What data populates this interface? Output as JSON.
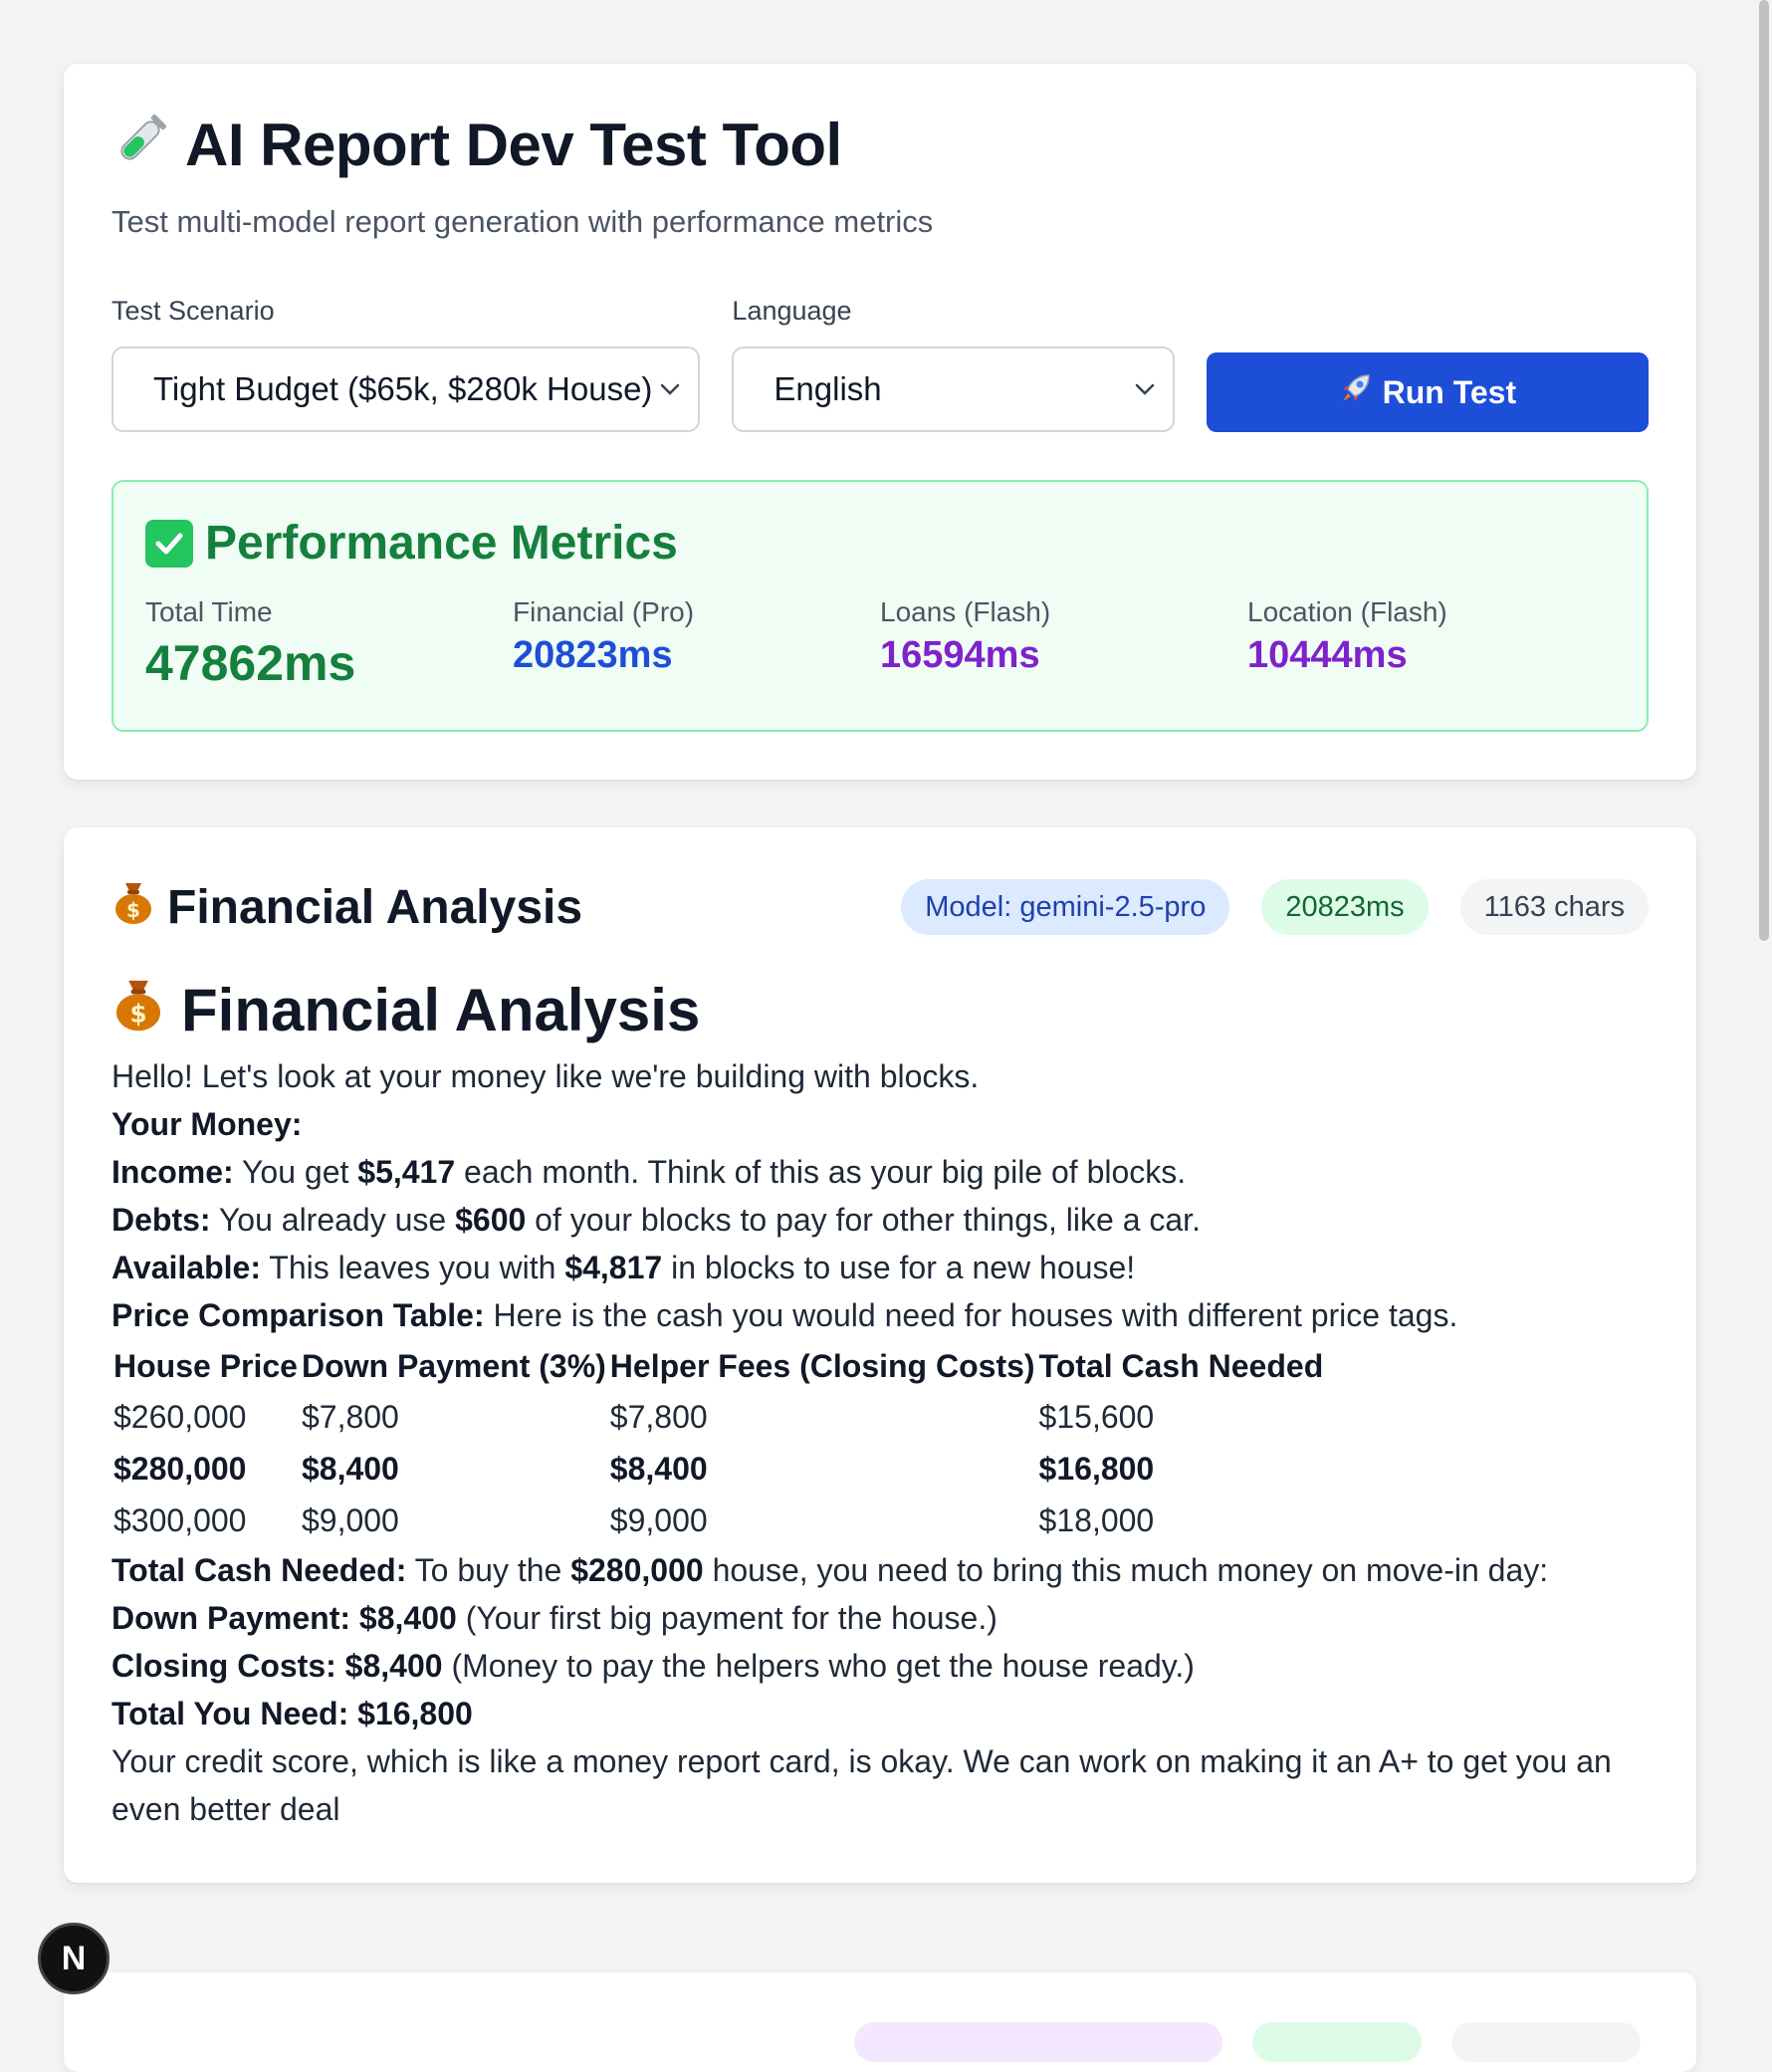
{
  "header": {
    "icon": "test-tube-icon",
    "title": "AI Report Dev Test Tool",
    "subtitle": "Test multi-model report generation with performance metrics"
  },
  "controls": {
    "scenario_label": "Test Scenario",
    "scenario_value": "Tight Budget ($65k, $280k House)",
    "language_label": "Language",
    "language_value": "English",
    "run_button_label": "Run Test",
    "run_button_icon": "rocket-icon"
  },
  "metrics": {
    "title": "Performance Metrics",
    "items": [
      {
        "label": "Total Time",
        "value": "47862ms",
        "color": "#15803d"
      },
      {
        "label": "Financial (Pro)",
        "value": "20823ms",
        "color": "#1d4ed8"
      },
      {
        "label": "Loans (Flash)",
        "value": "16594ms",
        "color": "#7e22ce"
      },
      {
        "label": "Location (Flash)",
        "value": "10444ms",
        "color": "#7e22ce"
      }
    ]
  },
  "financial": {
    "section_title": "Financial Analysis",
    "icon": "money-bag-icon",
    "badges": {
      "model": "Model: gemini-2.5-pro",
      "time": "20823ms",
      "chars": "1163 chars"
    },
    "report": {
      "heading": "Financial Analysis",
      "intro": "Hello! Let's look at your money like we're building with blocks.",
      "your_money": "Your Money:",
      "income_label": "Income:",
      "income_pre": "You get",
      "income_value": "$5,417",
      "income_post": "each month. Think of this as your big pile of blocks.",
      "debts_label": "Debts:",
      "debts_pre": "You already use",
      "debts_value": "$600",
      "debts_post": "of your blocks to pay for other things, like a car.",
      "available_label": "Available:",
      "available_pre": "This leaves you with",
      "available_value": "$4,817",
      "available_post": "in blocks to use for a new house!",
      "table_intro_label": "Price Comparison Table:",
      "table_intro_text": "Here is the cash you would need for houses with different price tags.",
      "table_headers": [
        "House Price",
        "Down Payment (3%)",
        "Helper Fees (Closing Costs)",
        "Total Cash Needed"
      ],
      "table_rows": [
        [
          "$260,000",
          "$7,800",
          "$7,800",
          "$15,600"
        ],
        [
          "$280,000",
          "$8,400",
          "$8,400",
          "$16,800"
        ],
        [
          "$300,000",
          "$9,000",
          "$9,000",
          "$18,000"
        ]
      ],
      "total_cash_label": "Total Cash Needed:",
      "total_cash_pre": "To buy the",
      "total_cash_value": "$280,000",
      "total_cash_post": "house, you need to bring this much money on move-in day:",
      "down_payment_label": "Down Payment: $8,400",
      "down_payment_text": "(Your first big payment for the house.)",
      "closing_costs_label": "Closing Costs: $8,400",
      "closing_costs_text": "(Money to pay the helpers who get the house ready.)",
      "total_need_label": "Total You Need: $16,800",
      "credit_text": "Your credit score, which is like a money report card, is okay. We can work on making it an A+ to get you an even better deal"
    }
  },
  "dev_indicator": {
    "label": "N"
  }
}
